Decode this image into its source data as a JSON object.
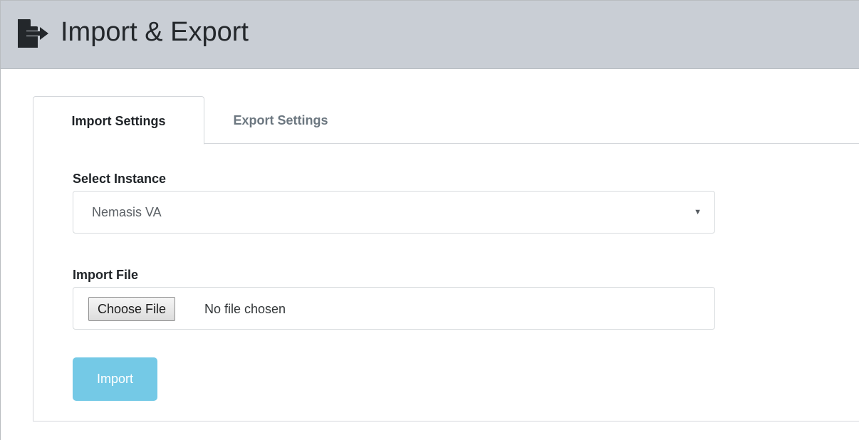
{
  "header": {
    "icon": "file-export-icon",
    "title": "Import & Export"
  },
  "tabs": [
    {
      "label": "Import Settings",
      "active": true
    },
    {
      "label": "Export Settings",
      "active": false
    }
  ],
  "import_form": {
    "instance_label": "Select Instance",
    "instance_selected": "Nemasis VA",
    "file_label": "Import File",
    "choose_file_label": "Choose File",
    "file_status": "No file chosen",
    "submit_label": "Import"
  },
  "colors": {
    "header_bg": "#c9ced5",
    "import_button": "#74c9e6"
  }
}
